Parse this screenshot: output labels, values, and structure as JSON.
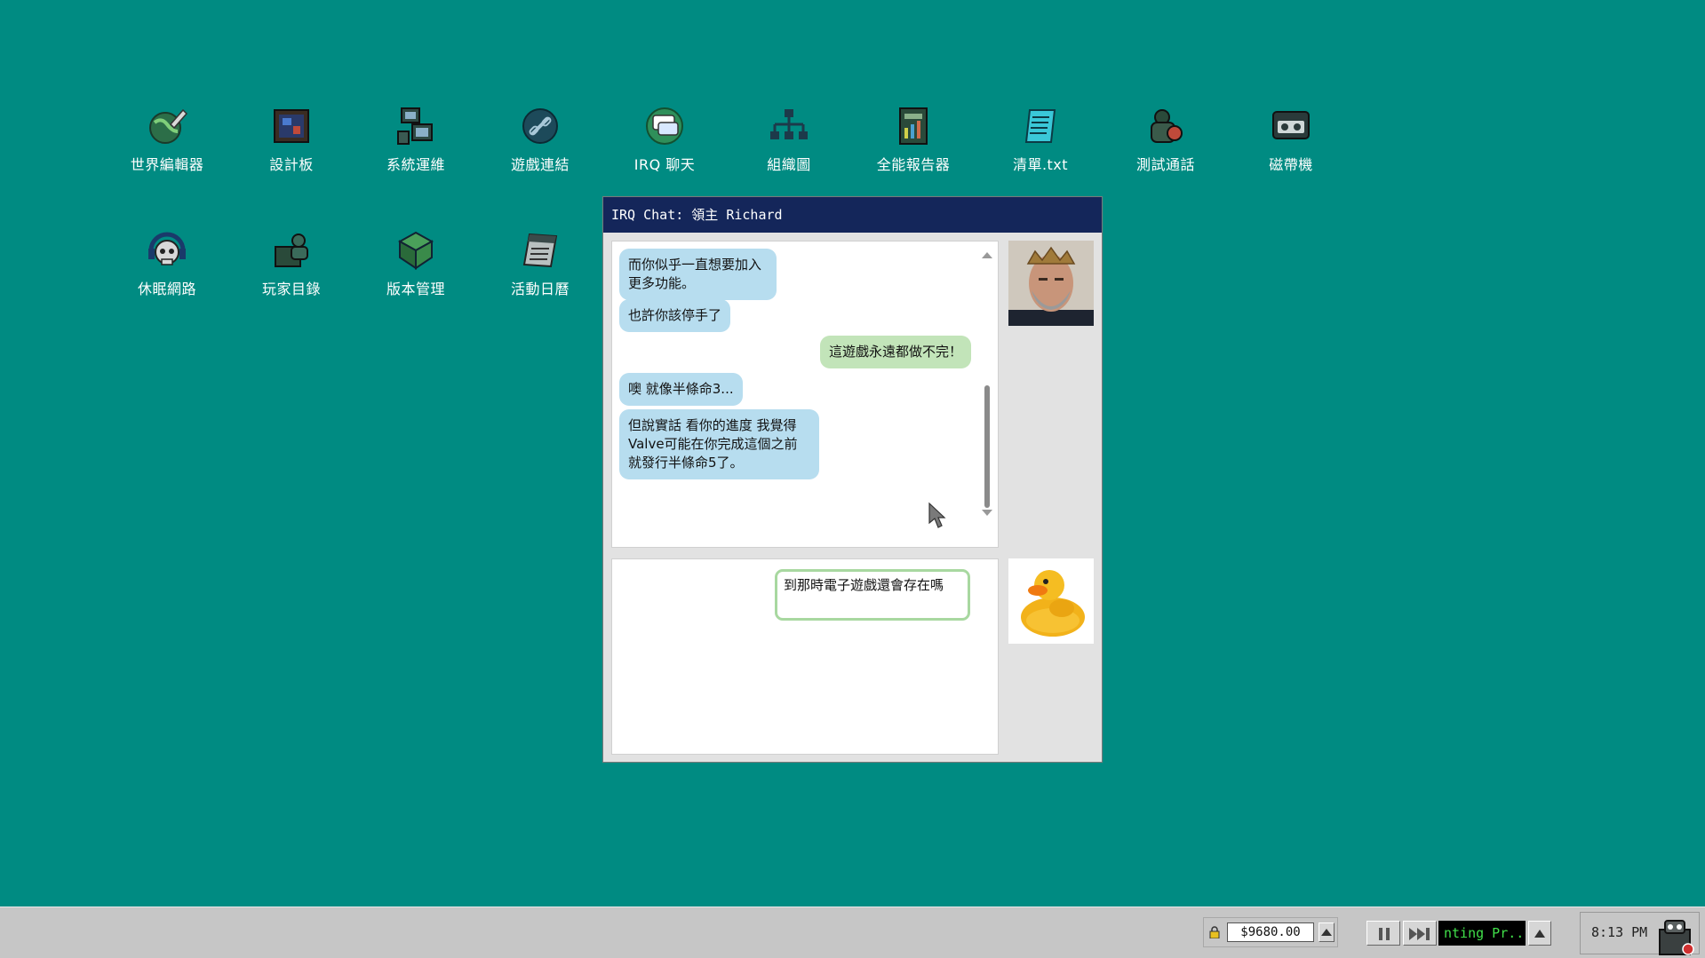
{
  "desktop": {
    "icons_row1": [
      {
        "label": "世界編輯器",
        "icon": "world-editor-icon"
      },
      {
        "label": "設計板",
        "icon": "design-board-icon"
      },
      {
        "label": "系統運維",
        "icon": "system-ops-icon"
      },
      {
        "label": "遊戲連結",
        "icon": "game-link-icon"
      },
      {
        "label": "IRQ 聊天",
        "icon": "irq-chat-icon"
      },
      {
        "label": "組織圖",
        "icon": "org-chart-icon"
      },
      {
        "label": "全能報告器",
        "icon": "reporter-icon"
      },
      {
        "label": "清單.txt",
        "icon": "notepad-icon"
      },
      {
        "label": "測試通話",
        "icon": "test-call-icon"
      },
      {
        "label": "磁帶機",
        "icon": "tape-drive-icon"
      }
    ],
    "icons_row2": [
      {
        "label": "休眠網路",
        "icon": "skull-headset-icon"
      },
      {
        "label": "玩家目錄",
        "icon": "player-directory-icon"
      },
      {
        "label": "版本管理",
        "icon": "version-control-icon"
      },
      {
        "label": "活動日曆",
        "icon": "calendar-icon"
      }
    ]
  },
  "chat": {
    "title": "IRQ Chat: 領主 Richard",
    "messages": [
      {
        "from": "them",
        "text": "而你似乎一直想要加入更多功能。"
      },
      {
        "from": "them",
        "text": "也許你該停手了"
      },
      {
        "from": "me",
        "text": "這遊戲永遠都做不完！"
      },
      {
        "from": "them",
        "text": "噢 就像半條命3..."
      },
      {
        "from": "them",
        "text": "但說實話 看你的進度 我覺得Valve可能在你完成這個之前就發行半條命5了。"
      }
    ],
    "draft": "到那時電子遊戲還會存在嗎"
  },
  "taskbar": {
    "money": "$9680.00",
    "status": "nting Pr...",
    "clock": "8:13 PM"
  },
  "colors": {
    "desktop": "#008b82",
    "titlebar": "#14265a",
    "incoming_bubble": "#b7ddef",
    "outgoing_bubble": "#c2e4b9"
  }
}
